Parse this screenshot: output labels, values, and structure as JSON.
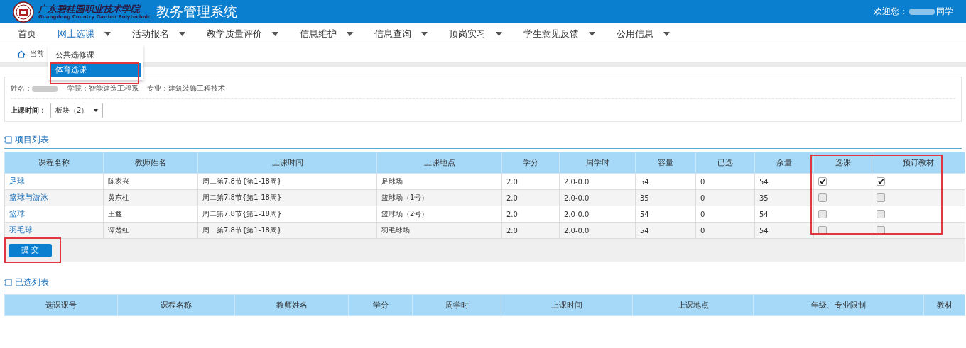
{
  "header": {
    "school_name": "广东碧桂园职业技术学院",
    "school_name_en": "Guangdong Country Garden Polytechnic",
    "system_title": "教务管理系统",
    "welcome_label": "欢迎您：",
    "user_suffix": "同学"
  },
  "nav": [
    {
      "label": "首页",
      "has_menu": false,
      "selected": false
    },
    {
      "label": "网上选课",
      "has_menu": true,
      "selected": true
    },
    {
      "label": "活动报名",
      "has_menu": true,
      "selected": false
    },
    {
      "label": "教学质量评价",
      "has_menu": true,
      "selected": false
    },
    {
      "label": "信息维护",
      "has_menu": true,
      "selected": false
    },
    {
      "label": "信息查询",
      "has_menu": true,
      "selected": false
    },
    {
      "label": "顶岗实习",
      "has_menu": true,
      "selected": false
    },
    {
      "label": "学生意见反馈",
      "has_menu": true,
      "selected": false
    },
    {
      "label": "公用信息",
      "has_menu": true,
      "selected": false
    }
  ],
  "dropdown": [
    {
      "label": "公共选修课",
      "selected": false
    },
    {
      "label": "体育选课",
      "selected": true
    }
  ],
  "breadcrumb": "当前",
  "student_info": {
    "name_label": "姓名：",
    "college": "学院：智能建造工程系",
    "major": "专业：建筑装饰工程技术"
  },
  "time_filter": {
    "label": "上课时间：",
    "value": "板块（2）"
  },
  "course_list": {
    "title": "项目列表",
    "columns": [
      "课程名称",
      "教师姓名",
      "上课时间",
      "上课地点",
      "学分",
      "周学时",
      "容量",
      "已选",
      "余量",
      "选课",
      "预订教材"
    ],
    "rows": [
      {
        "cells": [
          "足球",
          "陈家兴",
          "周二第7,8节{第1-18周}",
          "足球场",
          "2.0",
          "2.0-0.0",
          "54",
          "0",
          "54"
        ],
        "selected": true,
        "book": true
      },
      {
        "cells": [
          "篮球与游泳",
          "黄东柱",
          "周二第7,8节{第1-18周}",
          "篮球场（1号）",
          "2.0",
          "2.0-0.0",
          "35",
          "0",
          "35"
        ],
        "selected": false,
        "book": false
      },
      {
        "cells": [
          "篮球",
          "王鑫",
          "周二第7,8节{第1-18周}",
          "篮球场（2号）",
          "2.0",
          "2.0-0.0",
          "54",
          "0",
          "54"
        ],
        "selected": false,
        "book": false
      },
      {
        "cells": [
          "羽毛球",
          "谭楚红",
          "周二第7,8节{第1-18周}",
          "羽毛球场",
          "2.0",
          "2.0-0.0",
          "54",
          "0",
          "54"
        ],
        "selected": false,
        "book": false
      }
    ],
    "submit": "提 交"
  },
  "chosen_list": {
    "title": "已选列表",
    "columns": [
      "选课课号",
      "课程名称",
      "教师姓名",
      "学分",
      "周学时",
      "上课时间",
      "上课地点",
      "年级、专业限制",
      "教材"
    ]
  }
}
